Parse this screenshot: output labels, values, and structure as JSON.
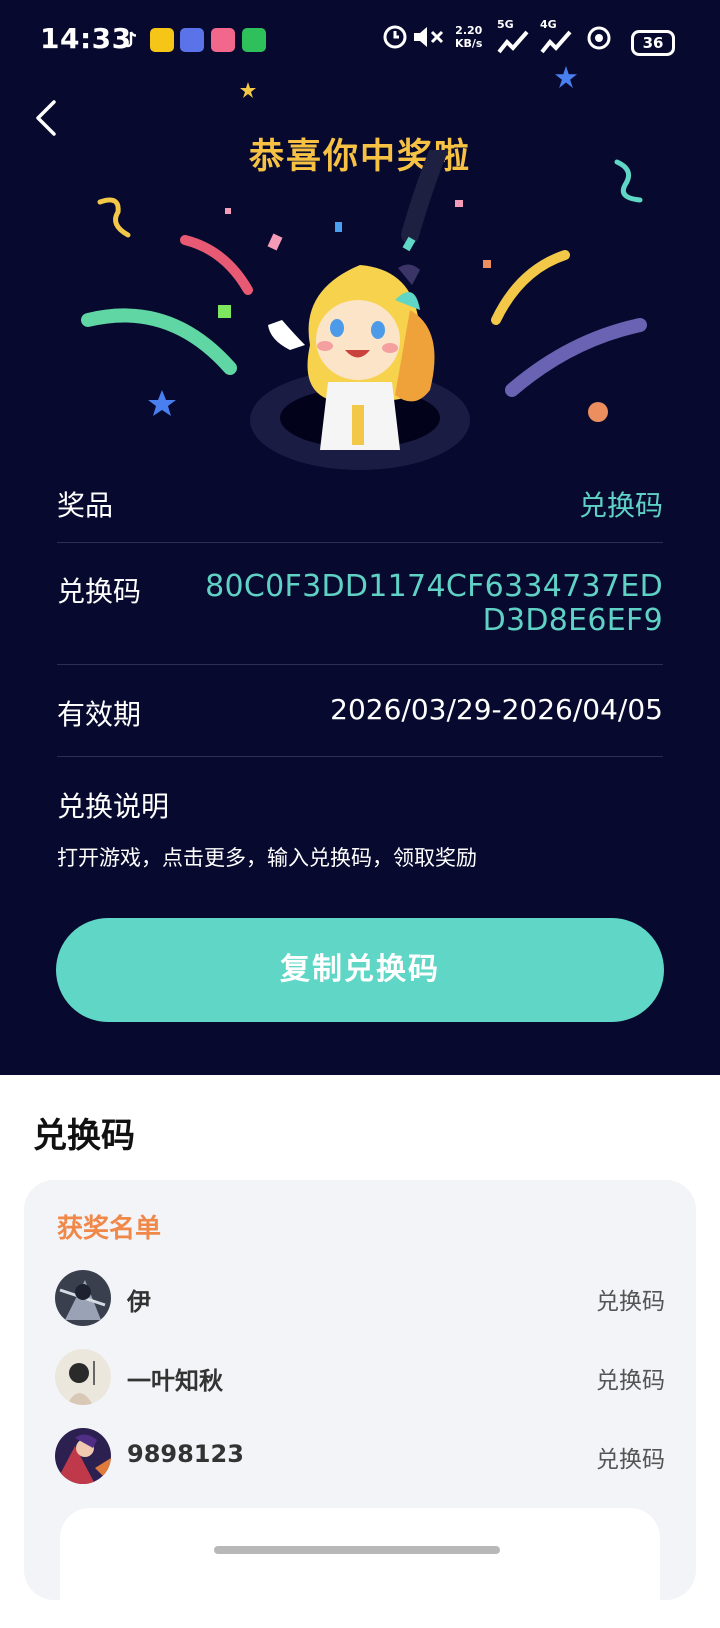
{
  "status_bar": {
    "time": "14:33",
    "speed": "2.20\nKB/s",
    "network_5g": "5G",
    "network_4g": "4G",
    "battery": "36"
  },
  "header": {
    "title": "恭喜你中奖啦"
  },
  "prize": {
    "prize_label": "奖品",
    "prize_value": "兑换码",
    "code_label": "兑换码",
    "code_value": "80C0F3DD1174CF6334737EDD3D8E6EF9",
    "validity_label": "有效期",
    "validity_value": "2026/03/29-2026/04/05",
    "desc_title": "兑换说明",
    "desc_text": "打开游戏，点击更多，输入兑换码，领取奖励",
    "copy_button": "复制兑换码"
  },
  "section": {
    "title": "兑换码"
  },
  "winners": {
    "title": "获奖名单",
    "items": [
      {
        "name": "伊",
        "prize": "兑换码"
      },
      {
        "name": "一叶知秋",
        "prize": "兑换码"
      },
      {
        "name": "9898123",
        "prize": "兑换码"
      }
    ]
  },
  "colors": {
    "background": "#070a2e",
    "accent": "#5fd1c5",
    "title": "#f7c244",
    "winners_title": "#f0884a"
  }
}
